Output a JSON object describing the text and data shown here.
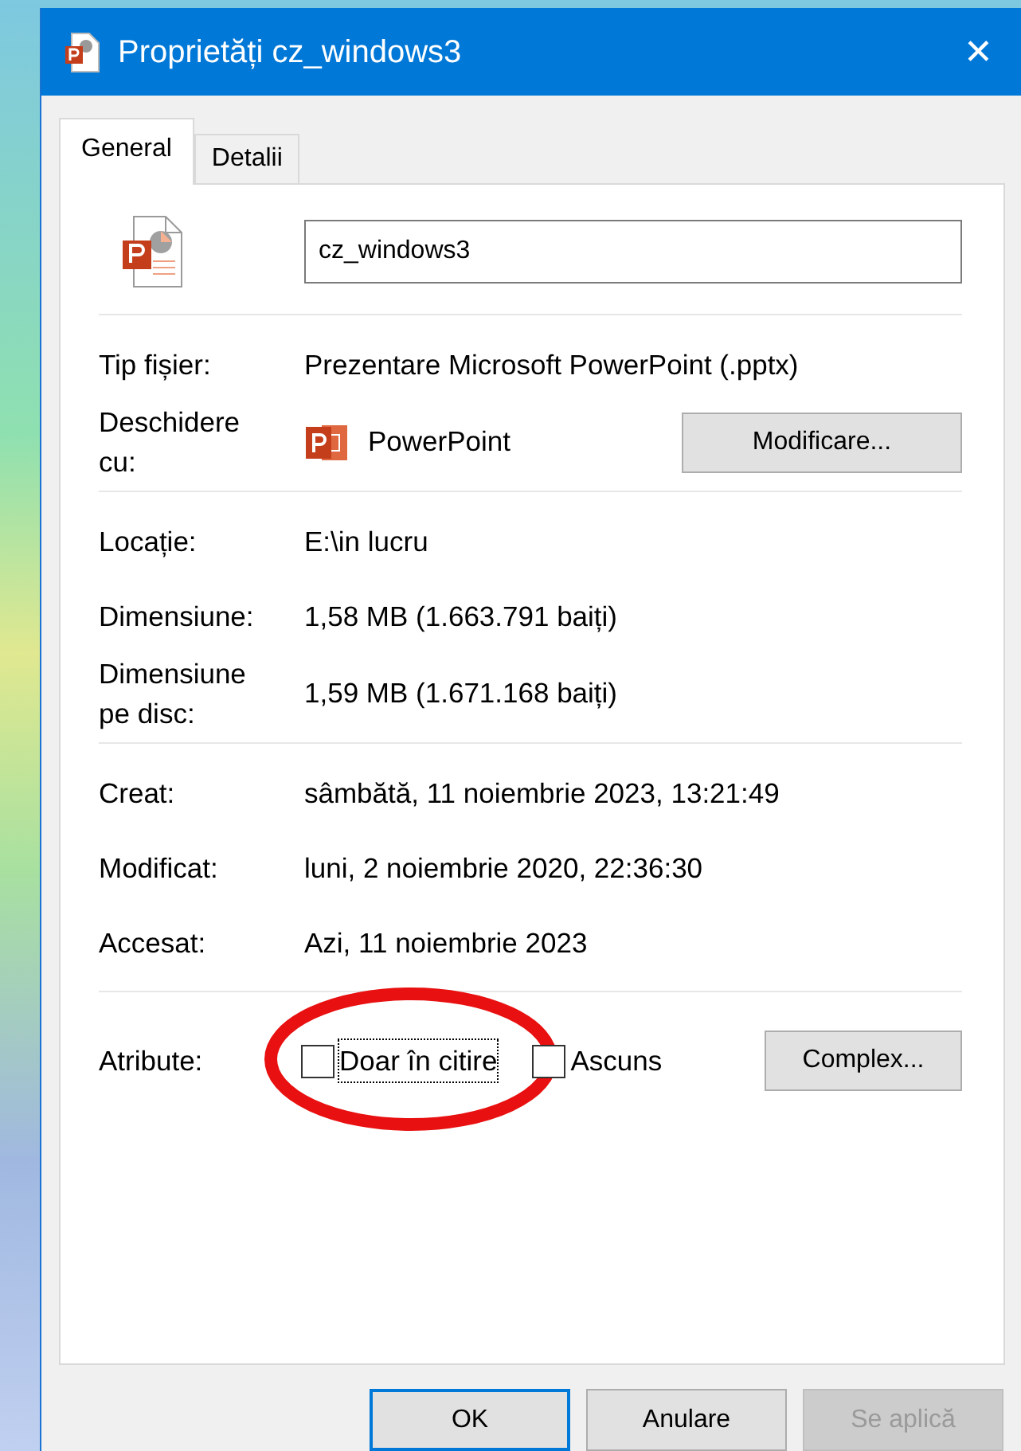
{
  "window": {
    "title": "Proprietăți cz_windows3",
    "close": "✕"
  },
  "tabs": [
    {
      "label": "General",
      "selected": true
    },
    {
      "label": "Detalii",
      "selected": false
    }
  ],
  "file_name": {
    "value": "cz_windows3"
  },
  "sections": [
    {
      "rows": [
        {
          "kind": "text",
          "label": "Tip fișier:",
          "value": "Prezentare Microsoft PowerPoint (.pptx)"
        },
        {
          "kind": "app",
          "label": "Deschidere cu:",
          "value": "PowerPoint",
          "button": "Modificare..."
        }
      ]
    },
    {
      "rows": [
        {
          "kind": "text",
          "label": "Locație:",
          "value": "E:\\in lucru"
        },
        {
          "kind": "text",
          "label": "Dimensiune:",
          "value": "1,58 MB (1.663.791 baiți)"
        },
        {
          "kind": "text",
          "label": "Dimensiune pe disc:",
          "value": "1,59 MB (1.671.168 baiți)"
        }
      ]
    },
    {
      "rows": [
        {
          "kind": "text",
          "label": "Creat:",
          "value": "sâmbătă, 11 noiembrie 2023, 13:21:49"
        },
        {
          "kind": "text",
          "label": "Modificat:",
          "value": "luni, 2 noiembrie 2020, 22:36:30"
        },
        {
          "kind": "text",
          "label": "Accesat:",
          "value": "Azi, 11 noiembrie 2023"
        }
      ]
    }
  ],
  "attributes": {
    "label": "Atribute:",
    "options": [
      {
        "label": "Doar în citire",
        "checked": false,
        "focused": true,
        "circled": true
      },
      {
        "label": "Ascuns",
        "checked": false,
        "focused": false,
        "circled": false
      }
    ],
    "button": "Complex..."
  },
  "buttons": [
    {
      "label": "OK",
      "default": true,
      "disabled": false
    },
    {
      "label": "Anulare",
      "default": false,
      "disabled": false
    },
    {
      "label": "Se aplică",
      "default": false,
      "disabled": true
    }
  ]
}
